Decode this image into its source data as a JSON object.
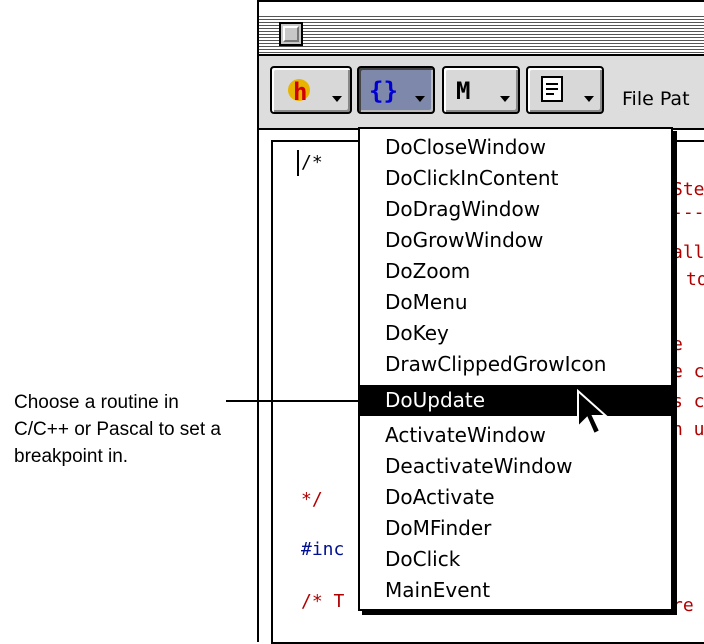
{
  "toolbar": {
    "file_path_label": "File Pat"
  },
  "menu": {
    "items": [
      "DoCloseWindow",
      "DoClickInContent",
      "DoDragWindow",
      "DoGrowWindow",
      "DoZoom",
      "DoMenu",
      "DoKey",
      "DrawClippedGrowIcon",
      "DoUpdate",
      "ActivateWindow",
      "DeactivateWindow",
      "DoActivate",
      "DoMFinder",
      "DoClick",
      "MainEvent"
    ],
    "selected": "DoUpdate"
  },
  "code": {
    "comment_open": "/*",
    "comment_close": "*/",
    "include_partial": "#inc",
    "comment_bottom": "/* T",
    "frag1": "Ste",
    "frag2": "---",
    "frag3": "all",
    "frag4": "to",
    "frag5": "e",
    "frag6": "e c",
    "frag7": "s c",
    "frag8": "n u",
    "frag9": "re"
  },
  "callout": {
    "text": "Choose a routine in C/C++ or Pascal to set a breakpoint in."
  },
  "colors": {
    "selection": "#000000",
    "code_comment": "#b00000",
    "code_keyword": "#001090"
  }
}
